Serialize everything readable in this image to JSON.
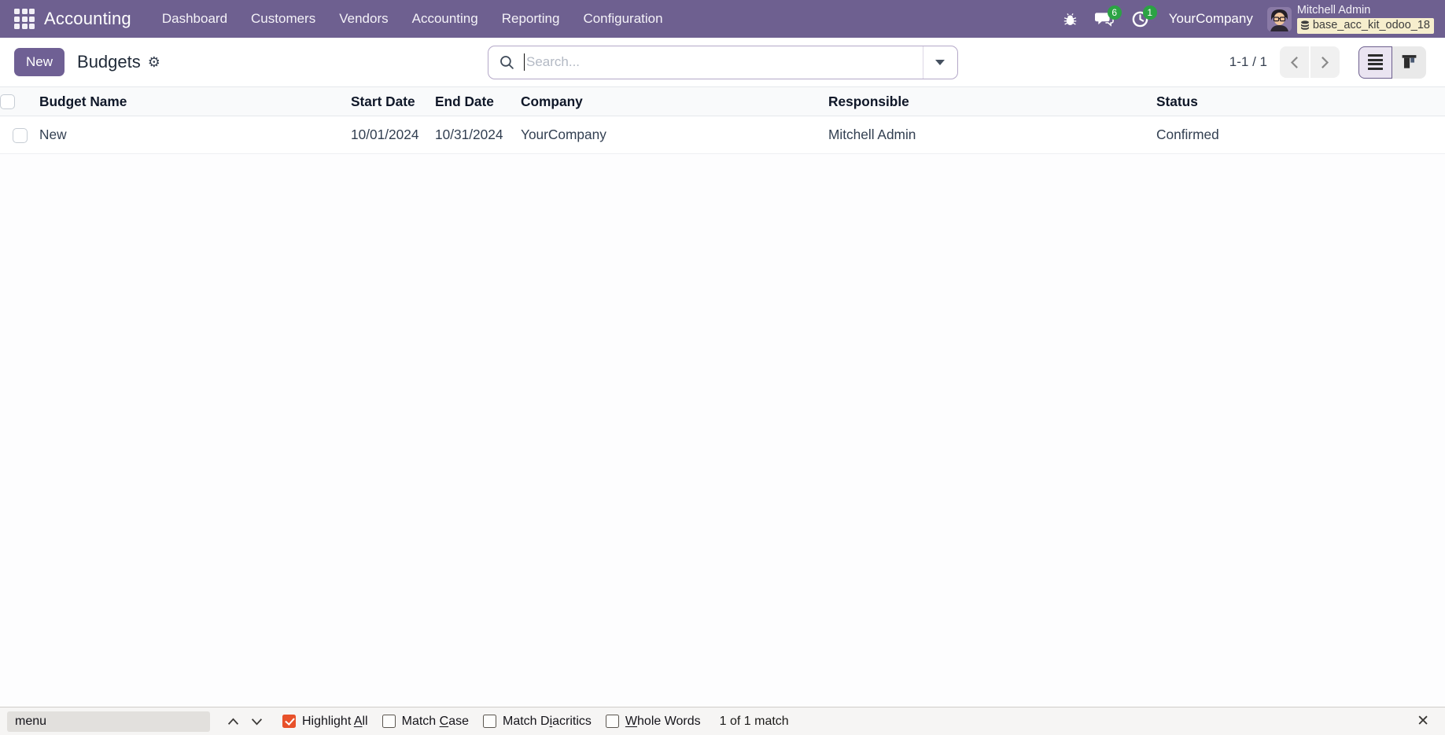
{
  "navbar": {
    "brand": "Accounting",
    "menu": {
      "dashboard": "Dashboard",
      "customers": "Customers",
      "vendors": "Vendors",
      "accounting": "Accounting",
      "reporting": "Reporting",
      "configuration": "Configuration"
    },
    "messages_badge": "6",
    "activities_badge": "1",
    "company": "YourCompany",
    "user_name": "Mitchell Admin",
    "db_badge": "base_acc_kit_odoo_18"
  },
  "control_panel": {
    "new_button": "New",
    "title": "Budgets",
    "search_placeholder": "Search...",
    "pager": "1-1 / 1"
  },
  "table": {
    "headers": {
      "budget_name": "Budget Name",
      "start_date": "Start Date",
      "end_date": "End Date",
      "company": "Company",
      "responsible": "Responsible",
      "status": "Status"
    },
    "rows": [
      {
        "budget_name": "New",
        "start_date": "10/01/2024",
        "end_date": "10/31/2024",
        "company": "YourCompany",
        "responsible": "Mitchell Admin",
        "status": "Confirmed"
      }
    ]
  },
  "findbar": {
    "query": "menu",
    "options": [
      {
        "pre": "Highlight ",
        "key": "A",
        "post": "ll",
        "checked": true
      },
      {
        "pre": "Match ",
        "key": "C",
        "post": "ase",
        "checked": false
      },
      {
        "pre": "Match D",
        "key": "i",
        "post": "acritics",
        "checked": false
      },
      {
        "pre": "",
        "key": "W",
        "post": "hole Words",
        "checked": false
      }
    ],
    "status": "1 of 1 match"
  },
  "colors": {
    "navbar_bg": "#6e6090",
    "primary_button": "#6f6094",
    "notification_green": "#2ba344",
    "db_badge_bg": "#f6eecd",
    "findbar_checkbox_checked": "#e8512a"
  }
}
